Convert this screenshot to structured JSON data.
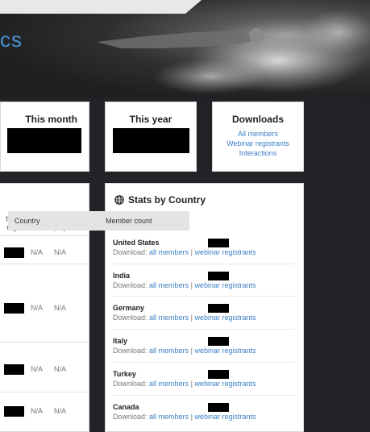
{
  "header": {
    "title_fragment": "cs"
  },
  "cards": {
    "this_month": {
      "title": "This month"
    },
    "this_year": {
      "title": "This year"
    },
    "downloads": {
      "title": "Downloads",
      "links": [
        "All members",
        "Webinar registrants",
        "Interactions"
      ]
    }
  },
  "stats_table": {
    "headers": [
      [
        "total",
        "reg."
      ],
      [
        "total",
        "live"
      ],
      [
        "total",
        "plays"
      ]
    ],
    "rows": [
      {
        "live": "N/A",
        "plays": "N/A"
      },
      {
        "live": "N/A",
        "plays": "N/A"
      },
      {
        "live": "N/A",
        "plays": "N/A"
      },
      {
        "live": "N/A",
        "plays": "N/A"
      }
    ]
  },
  "country": {
    "title": "Stats by Country",
    "icon": "globe-icon",
    "columns": {
      "country": "Country",
      "members": "Member count"
    },
    "download_label": "Download:",
    "link_all": "all members",
    "link_separator": "|",
    "link_webinar": "webinar registrants",
    "rows": [
      {
        "name": "United States"
      },
      {
        "name": "India"
      },
      {
        "name": "Germany"
      },
      {
        "name": "Italy"
      },
      {
        "name": "Turkey"
      },
      {
        "name": "Canada"
      }
    ]
  },
  "colors": {
    "accent": "#3b7fc4",
    "title_blue": "#4a8fd0",
    "page_bg": "#222326"
  }
}
